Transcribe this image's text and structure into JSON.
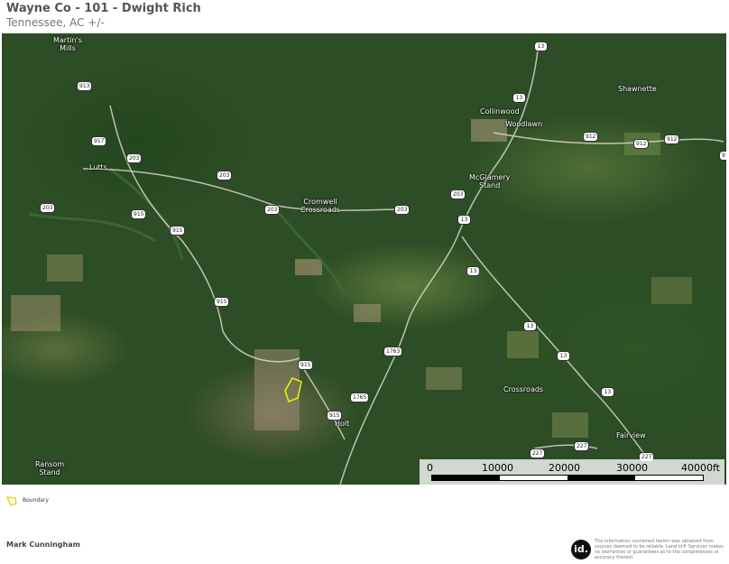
{
  "header": {
    "title": "Wayne Co - 101 - Dwight Rich",
    "subtitle": "Tennessee,  AC +/-"
  },
  "map": {
    "places": [
      {
        "id": "martins-mills",
        "label": "Martin's\nMills"
      },
      {
        "id": "lutts",
        "label": "Lutts"
      },
      {
        "id": "cromwell-crossroads",
        "label": "Cromwell\nCrossroads"
      },
      {
        "id": "collinwood",
        "label": "Collinwood"
      },
      {
        "id": "woodlawn",
        "label": "Woodlawn"
      },
      {
        "id": "shawnette",
        "label": "Shawnette"
      },
      {
        "id": "mcglamery-stand",
        "label": "McGlamery\nStand"
      },
      {
        "id": "crossroads",
        "label": "Crossroads"
      },
      {
        "id": "holt",
        "label": "Holt"
      },
      {
        "id": "fairview",
        "label": "Fairview"
      },
      {
        "id": "ransom-stand",
        "label": "Ransom\nStand"
      }
    ],
    "routes": [
      "13",
      "13",
      "13",
      "13",
      "13",
      "13",
      "13",
      "912",
      "912",
      "912",
      "917",
      "917",
      "203",
      "203",
      "203",
      "203",
      "203",
      "915",
      "915",
      "915",
      "915",
      "915",
      "203",
      "1763",
      "1765",
      "227",
      "227",
      "227",
      "913"
    ],
    "boundary_color": "#e8f000"
  },
  "scalebar": {
    "ticks": [
      "0",
      "10000",
      "20000",
      "30000",
      "40000ft"
    ]
  },
  "legend": {
    "boundary_label": "Boundary"
  },
  "footer": {
    "agent_name": "Mark Cunningham",
    "logo_text": "id.",
    "disclaimer": "The information contained herein was obtained from sources deemed to be reliable. Land id® Services makes no warranties or guarantees as to the completeness or accuracy thereof."
  }
}
